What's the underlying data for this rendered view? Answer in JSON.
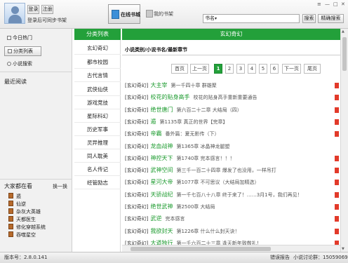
{
  "header": {
    "login_label": "登录",
    "register_label": "注册",
    "login_hint": "登录后可同步书架",
    "tab_online": "在线书城",
    "tab_shelf": "我的书架",
    "search_type": "书名",
    "search_label": "搜索",
    "exact_search_label": "精确搜索"
  },
  "sidebar": {
    "nav": [
      "今日热门",
      "分类列表",
      "小说搜索"
    ],
    "recent_title": "最近阅读",
    "watching_title": "大家都在看",
    "refresh_label": "换一换",
    "hot_books": [
      "遁",
      "仙逆",
      "杂灰大英雄",
      "天都医生",
      "修化穿越系统",
      "吞噬星空"
    ]
  },
  "categories": {
    "header": "分类列表",
    "items": [
      "玄幻奇幻",
      "都市校园",
      "古代言情",
      "武侠仙侠",
      "游戏竞技",
      "星际科幻",
      "历史军事",
      "灵异推理",
      "同人耽美",
      "名人传记",
      "经管励志"
    ]
  },
  "main": {
    "header": "玄幻奇幻",
    "column_heading": "小说类别/小说书名/最新章节",
    "pager": [
      "首页",
      "上一页",
      "1",
      "2",
      "3",
      "4",
      "5",
      "6",
      "下一页",
      "尾页"
    ],
    "rows": [
      {
        "cat": "[玄幻奇幻]",
        "title": "大主宰",
        "chapter": "第一千四十章 群雄聚",
        "new": true
      },
      {
        "cat": "[玄幻奇幻]",
        "title": "校花的贴身高手",
        "chapter": "校花的贴身高手重新重要通告",
        "new": true
      },
      {
        "cat": "[玄幻奇幻]",
        "title": "绝世唐门",
        "chapter": "第六百二十二章 大结局（四）",
        "new": true
      },
      {
        "cat": "[玄幻奇幻]",
        "title": "遁",
        "chapter": "第1135章 真正的世界【完章】",
        "new": true
      },
      {
        "cat": "[玄幻奇幻]",
        "title": "帝霸",
        "chapter": "番外篇：夏无影传（下）",
        "new": true
      },
      {
        "cat": "[玄幻奇幻]",
        "title": "龙血战神",
        "chapter": "第1365章 冰晶神龙腿塑",
        "new": false
      },
      {
        "cat": "[玄幻奇幻]",
        "title": "神控天下",
        "chapter": "第1740章 完本感言！！！",
        "new": true
      },
      {
        "cat": "[玄幻奇幻]",
        "title": "武神空间",
        "chapter": "第三千一百二十四章 爆发了也没用，一样吊打",
        "new": true
      },
      {
        "cat": "[玄幻奇幻]",
        "title": "星河大帝",
        "chapter": "第1077章 不可思议（大结局加精选）",
        "new": true
      },
      {
        "cat": "[玄幻奇幻]",
        "title": "天骄战纪",
        "chapter": "第一千七百八十八章 终于来了！……3月1号，我们再见！",
        "new": true
      },
      {
        "cat": "[玄幻奇幻]",
        "title": "绝世武神",
        "chapter": "第2500章 大结局",
        "new": true
      },
      {
        "cat": "[玄幻奇幻]",
        "title": "武逆",
        "chapter": "完本感言",
        "new": true
      },
      {
        "cat": "[玄幻奇幻]",
        "title": "我欲封天",
        "chapter": "第1226章 什么什么封天诀！",
        "new": true
      },
      {
        "cat": "[玄幻奇幻]",
        "title": "大道独行",
        "chapter": "第一千六百二十三章 逢天新年致敬礼！",
        "new": true
      }
    ]
  },
  "status": {
    "version": "版本号：2.8.0.141",
    "report": "错误报告",
    "count": "小说讨论群：150590699"
  },
  "colors": {
    "accent": "#23a03a",
    "title_green": "#1a9a2c",
    "new_flag": "#e23a2a"
  }
}
